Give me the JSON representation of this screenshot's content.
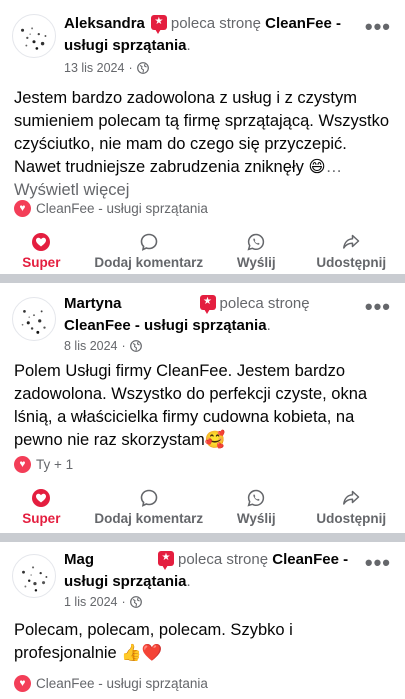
{
  "posts": [
    {
      "author": "Aleksandra",
      "recommends_text": "poleca stronę",
      "page_name": "CleanFee - usługi sprzątania",
      "date": "13 lis 2024",
      "body": "Jestem bardzo zadowolona z usług i z czystym sumieniem polecam tą firmę sprzątającą. Wszystko czyściutko, nie mam do czego się przyczepić. Nawet trudniejsze zabrudzenia zniknęły 😄",
      "see_more": "… Wyświetl więcej",
      "reaction_text": "CleanFee - usługi sprzątania"
    },
    {
      "author": "Martyna",
      "recommends_text": "poleca stronę",
      "page_name": "CleanFee - usługi sprzątania",
      "date": "8 lis 2024",
      "body": "Polem Usługi firmy CleanFee. Jestem bardzo zadowolona. Wszystko do perfekcji czyste, okna lśnią, a właścicielka firmy cudowna kobieta, na pewno nie raz skorzystam🥰",
      "reaction_text": "Ty + 1"
    },
    {
      "author": "Mag",
      "recommends_text": "poleca stronę",
      "page_name": "CleanFee - usługi sprzątania",
      "date": "1 lis 2024",
      "body": "Polecam, polecam, polecam. Szybko i profesjonalnie 👍❤️",
      "reaction_text": "CleanFee - usługi sprzątania"
    }
  ],
  "actions": {
    "super": "Super",
    "comment": "Dodaj komentarz",
    "send": "Wyślij",
    "share": "Udostępnij"
  },
  "more_icon": "•••",
  "colors": {
    "accent_red": "#e41e3f",
    "secondary_text": "#65676b",
    "separator": "#c9ccd1"
  },
  "icons": [
    "recommend-icon",
    "globe-icon",
    "more-options-icon",
    "heart-icon",
    "comment-icon",
    "whatsapp-icon",
    "share-icon",
    "reaction-heart-icon"
  ]
}
